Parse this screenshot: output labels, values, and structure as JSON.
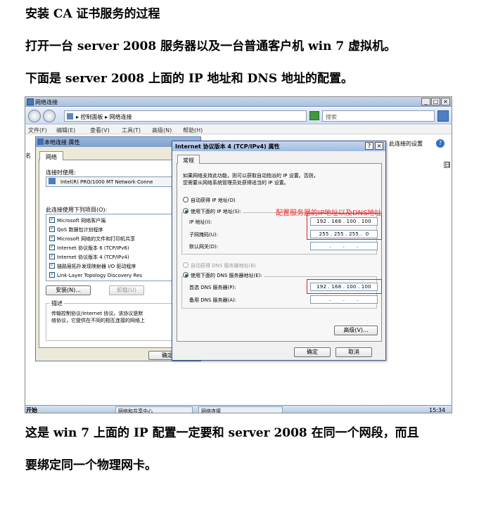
{
  "doc": {
    "p1": "安装 CA 证书服务的过程",
    "p2": "打开一台 server 2008 服务器以及一台普通客户机 win 7 虚拟机。",
    "p3": "下面是 server 2008 上面的 IP 地址和 DNS 地址的配置。",
    "p4": "这是 win 7 上面的 IP 配置一定要和 server 2008 在同一个网段，而且",
    "p5": "要绑定同一个物理网卡。"
  },
  "screenshot": {
    "window_title": "网络连接",
    "window_buttons": [
      "_",
      "□",
      "×"
    ],
    "address_path": "▸ 控制面板 ▸ 网络连接",
    "search_placeholder": "搜索",
    "menu": [
      "文件(F)",
      "编辑(E)",
      "查看(V)",
      "工具(T)",
      "高级(N)",
      "帮助(H)"
    ],
    "right_toolbar_text": "此连接的设置",
    "left_edge_text": "名",
    "collapse_glyph": "日",
    "icons": {
      "back": "back-arrow-icon",
      "forward": "forward-arrow-icon",
      "address": "control-panel-icon",
      "go": "refresh-icon",
      "search": "search-icon",
      "help": "help-icon"
    },
    "colors": {
      "annotation": "#ff2020",
      "highlight_box": "#e02020"
    },
    "local_dialog": {
      "title": "本地连接 属性",
      "tab": "网络",
      "connect_using_label": "连接时使用:",
      "adapter": "Intel(R) PRO/1000 MT Network Conne",
      "items_label": "此连接使用下列项目(O):",
      "items": [
        "Microsoft 网络客户端",
        "QoS 数据包计划程序",
        "Microsoft 网络的文件和打印机共享",
        "Internet 协议版本 6 (TCP/IPv6)",
        "Internet 协议版本 4 (TCP/IPv4)",
        "链路层拓扑发现映射器 I/O 驱动程序",
        "Link-Layer Topology Discovery Res"
      ],
      "install_button": "安装(N)...",
      "uninstall_button": "卸载(U)",
      "description_label": "描述",
      "description_line1": "传输控制协议/Internet 协议。该协议是默",
      "description_line2": "络协议，它提供在不同的相互连接的网络上",
      "ok_button": "确定"
    },
    "ipv4_dialog": {
      "title": "Internet 协议版本 4 (TCP/IPv4) 属性",
      "help_btn": "?",
      "close_btn": "×",
      "tab": "常规",
      "intro_line1": "如果网络支持此功能，则可以获取自动指派的 IP 设置。否则，",
      "intro_line2": "您需要从网络系统管理员处获得适当的 IP 设置。",
      "auto_ip": "自动获得 IP 地址(O)",
      "manual_ip": "使用下面的 IP 地址(S):",
      "ip_label": "IP 地址(I):",
      "ip_value": "192 . 168 . 100 . 100",
      "mask_label": "子网掩码(U):",
      "mask_value": "255 . 255 . 255 .  0",
      "gateway_label": "默认网关(D):",
      "gateway_value": ".       .       .",
      "auto_dns": "自动获得 DNS 服务器地址(B)",
      "manual_dns": "使用下面的 DNS 服务器地址(E):",
      "dns1_label": "首选 DNS 服务器(P):",
      "dns1_value": "192 . 168 . 100 . 100",
      "dns2_label": "备用 DNS 服务器(A):",
      "dns2_value": ".       .       .",
      "advanced_button": "高级(V)...",
      "ok_button": "确定",
      "cancel_button": "取消"
    },
    "annotation": "配置服务器的IP地址以及DNS地址",
    "taskbar": {
      "start": "开始",
      "items": [
        "网络和共享中心",
        "网络连接"
      ],
      "clock": "15:34"
    }
  }
}
